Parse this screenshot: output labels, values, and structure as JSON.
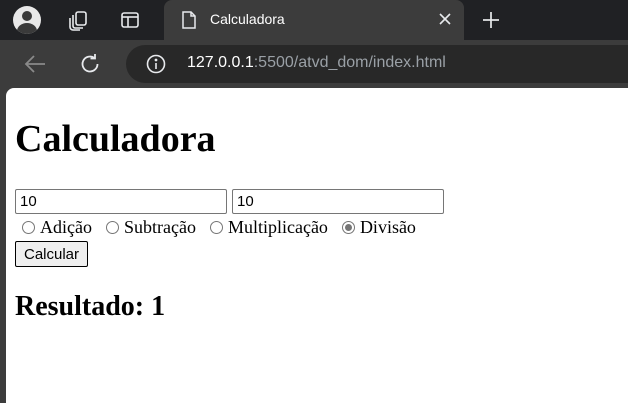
{
  "browser": {
    "tab": {
      "title": "Calculadora"
    },
    "address": {
      "host": "127.0.0.1",
      "rest": ":5500/atvd_dom/index.html"
    }
  },
  "page": {
    "heading": "Calculadora",
    "inputs": {
      "first_value": "10",
      "second_value": "10"
    },
    "operations": [
      {
        "label": "Adição",
        "checked": false
      },
      {
        "label": "Subtração",
        "checked": false
      },
      {
        "label": "Multiplicação",
        "checked": false
      },
      {
        "label": "Divisão",
        "checked": true
      }
    ],
    "calculate_label": "Calcular",
    "result": "Resultado: 1"
  }
}
